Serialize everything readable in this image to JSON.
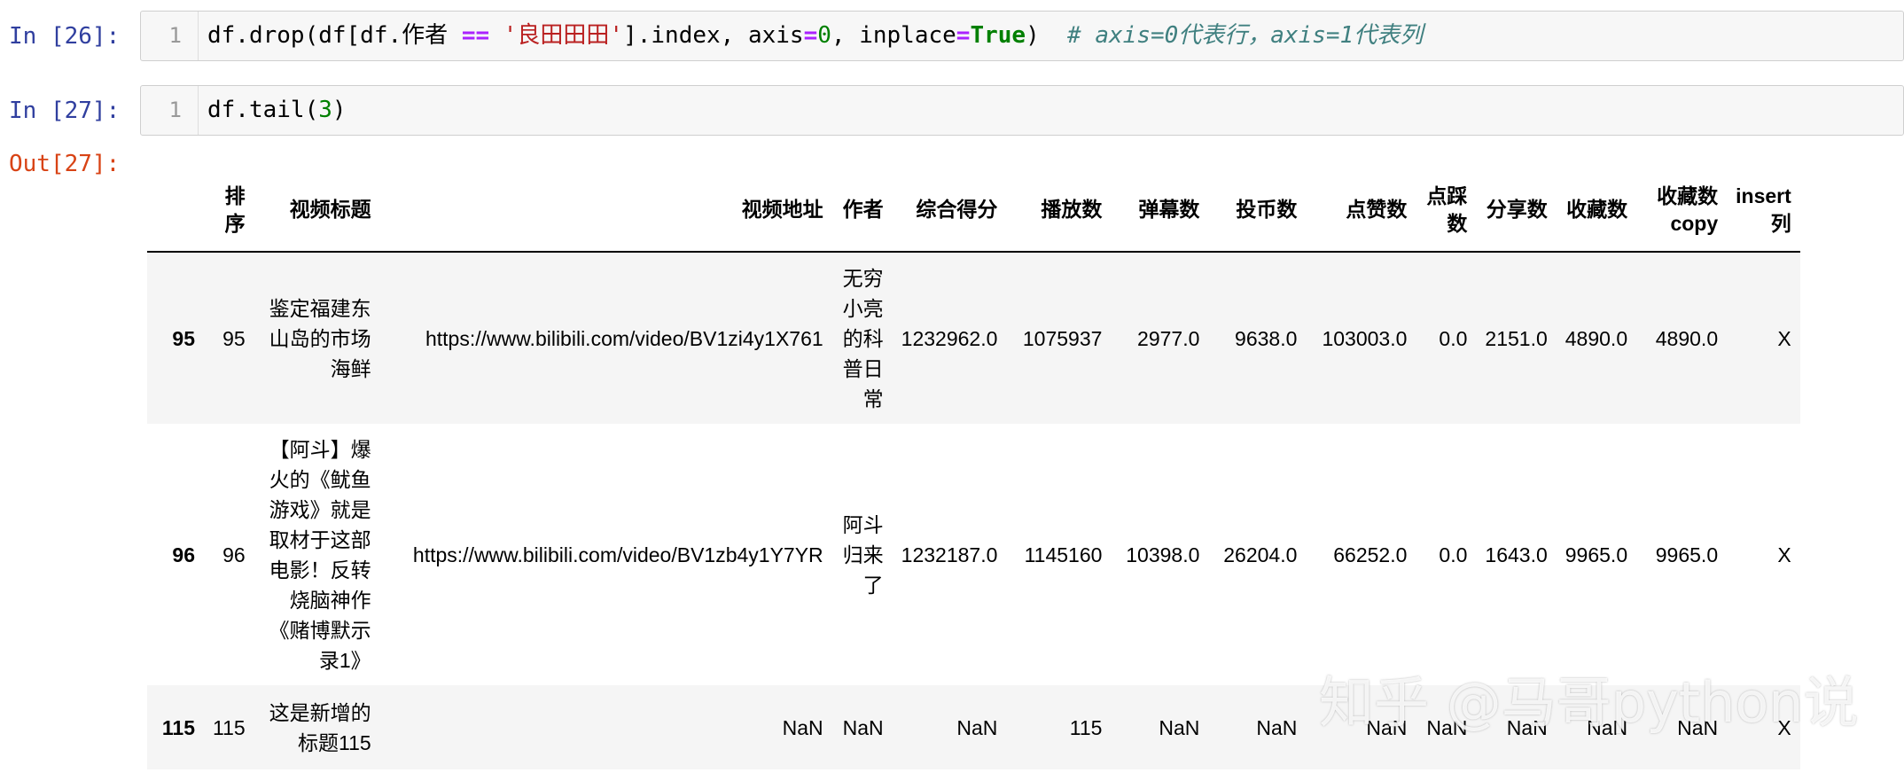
{
  "cells": [
    {
      "prompt": "In [26]:",
      "line_no": "1",
      "code": [
        {
          "t": "df.drop(df[df.作者 ",
          "c": ""
        },
        {
          "t": "==",
          "c": "kw-op"
        },
        {
          "t": " ",
          "c": ""
        },
        {
          "t": "'良田田田'",
          "c": "str"
        },
        {
          "t": "].index, axis",
          "c": ""
        },
        {
          "t": "=",
          "c": "kw-op"
        },
        {
          "t": "0",
          "c": "num"
        },
        {
          "t": ", inplace",
          "c": ""
        },
        {
          "t": "=",
          "c": "kw-op"
        },
        {
          "t": "True",
          "c": "kw"
        },
        {
          "t": ")  ",
          "c": ""
        },
        {
          "t": "# axis=0代表行，axis=1代表列",
          "c": "cmt"
        }
      ]
    },
    {
      "prompt": "In [27]:",
      "line_no": "1",
      "code": [
        {
          "t": "df.tail(",
          "c": ""
        },
        {
          "t": "3",
          "c": "num"
        },
        {
          "t": ")",
          "c": ""
        }
      ]
    }
  ],
  "output_prompt": "Out[27]:",
  "table": {
    "columns": [
      "排序",
      "视频标题",
      "视频地址",
      "作者",
      "综合得分",
      "播放数",
      "弹幕数",
      "投币数",
      "点赞数",
      "点踩数",
      "分享数",
      "收藏数",
      "收藏数copy",
      "insert列"
    ],
    "rows": [
      {
        "index": "95",
        "cells": [
          "95",
          "鉴定福建东山岛的市场海鲜",
          "https://www.bilibili.com/video/BV1zi4y1X761",
          "无穷小亮的科普日常",
          "1232962.0",
          "1075937",
          "2977.0",
          "9638.0",
          "103003.0",
          "0.0",
          "2151.0",
          "4890.0",
          "4890.0",
          "X"
        ]
      },
      {
        "index": "96",
        "cells": [
          "96",
          "【阿斗】爆火的《鱿鱼游戏》就是取材于这部电影！反转烧脑神作《赌博默示录1》",
          "https://www.bilibili.com/video/BV1zb4y1Y7YR",
          "阿斗归来了",
          "1232187.0",
          "1145160",
          "10398.0",
          "26204.0",
          "66252.0",
          "0.0",
          "1643.0",
          "9965.0",
          "9965.0",
          "X"
        ]
      },
      {
        "index": "115",
        "cells": [
          "115",
          "这是新增的标题115",
          "NaN",
          "NaN",
          "NaN",
          "115",
          "NaN",
          "NaN",
          "NaN",
          "NaN",
          "NaN",
          "NaN",
          "NaN",
          "X"
        ]
      }
    ]
  },
  "watermark": "知乎 @马哥python说"
}
